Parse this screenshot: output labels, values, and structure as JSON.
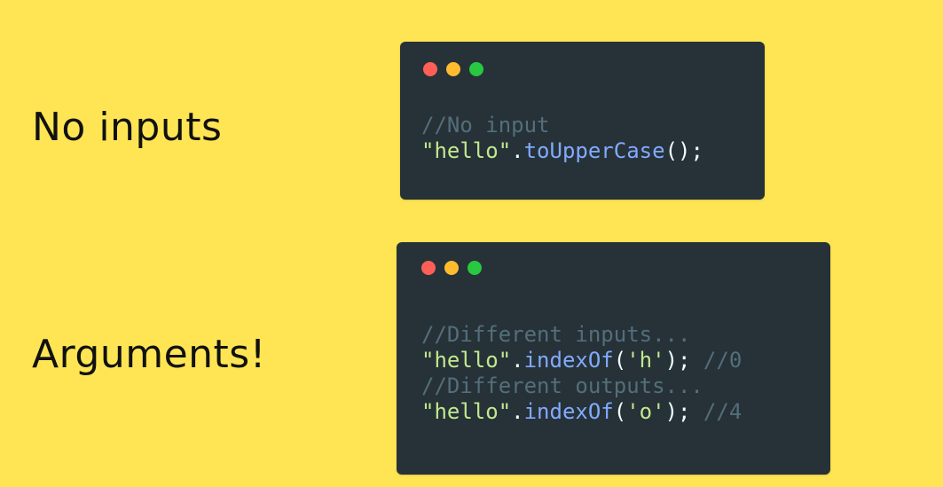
{
  "colors": {
    "background": "#ffe553",
    "window_bg": "#263238",
    "dot_red": "#ff5f57",
    "dot_yellow": "#febc2e",
    "dot_green": "#28c840",
    "comment": "#546e7a",
    "string": "#c3e88d",
    "method": "#82aaff",
    "punct": "#eeffff"
  },
  "sections": [
    {
      "label": "No inputs",
      "window": {
        "controls": [
          "close-dot",
          "minimize-dot",
          "maximize-dot"
        ],
        "lines": [
          {
            "comment": "//No input"
          },
          {
            "string": "\"hello\"",
            "dot": ".",
            "method": "toUpperCase",
            "rest": "();"
          }
        ]
      }
    },
    {
      "label": "Arguments!",
      "window": {
        "controls": [
          "close-dot",
          "minimize-dot",
          "maximize-dot"
        ],
        "lines": [
          {
            "comment": "//Different inputs..."
          },
          {
            "string": "\"hello\"",
            "dot": ".",
            "method": "indexOf",
            "open": "(",
            "arg": "'h'",
            "close": ");",
            "trailing": " //0"
          },
          {
            "comment": "//Different outputs..."
          },
          {
            "string": "\"hello\"",
            "dot": ".",
            "method": "indexOf",
            "open": "(",
            "arg": "'o'",
            "close": ");",
            "trailing": " //4"
          }
        ]
      }
    }
  ]
}
